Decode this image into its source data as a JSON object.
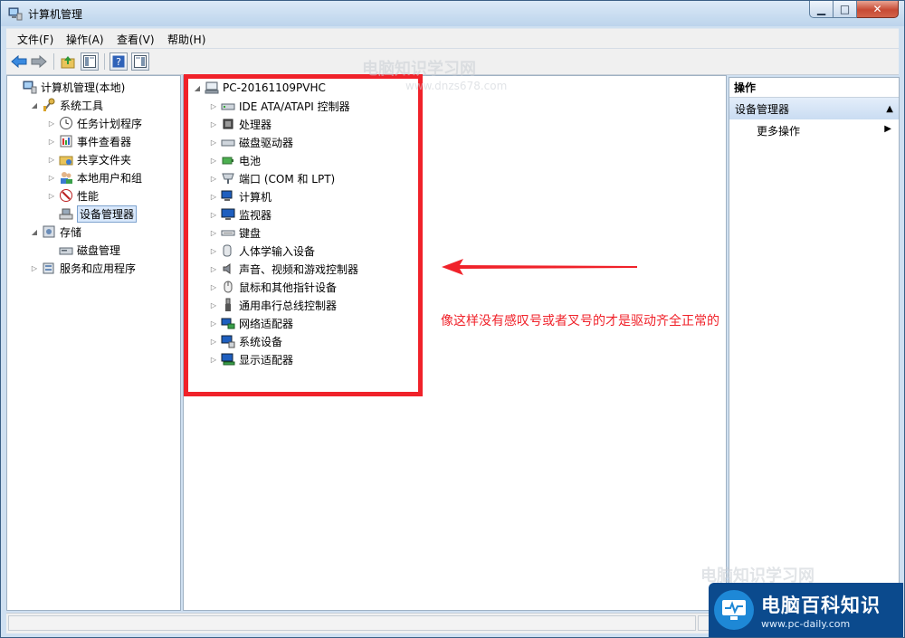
{
  "window": {
    "title": "计算机管理"
  },
  "menu": [
    "文件(F)",
    "操作(A)",
    "查看(V)",
    "帮助(H)"
  ],
  "toolbar": {
    "icons": [
      "back-arrow-icon",
      "forward-arrow-icon",
      "up-folder-icon",
      "show-tree-icon",
      "help-icon",
      "show-action-pane-icon"
    ]
  },
  "left_tree": [
    {
      "label": "计算机管理(本地)",
      "level": 0,
      "expander": "none",
      "icon": "computer-management-icon"
    },
    {
      "label": "系统工具",
      "level": 1,
      "expander": "open",
      "icon": "tools-icon"
    },
    {
      "label": "任务计划程序",
      "level": 2,
      "expander": "closed",
      "icon": "clock-icon"
    },
    {
      "label": "事件查看器",
      "level": 2,
      "expander": "closed",
      "icon": "event-viewer-icon"
    },
    {
      "label": "共享文件夹",
      "level": 2,
      "expander": "closed",
      "icon": "shared-folder-icon"
    },
    {
      "label": "本地用户和组",
      "level": 2,
      "expander": "closed",
      "icon": "users-icon"
    },
    {
      "label": "性能",
      "level": 2,
      "expander": "closed",
      "icon": "performance-icon"
    },
    {
      "label": "设备管理器",
      "level": 2,
      "expander": "none",
      "icon": "device-manager-icon",
      "selected": true
    },
    {
      "label": "存储",
      "level": 1,
      "expander": "open",
      "icon": "storage-icon"
    },
    {
      "label": "磁盘管理",
      "level": 2,
      "expander": "none",
      "icon": "disk-management-icon"
    },
    {
      "label": "服务和应用程序",
      "level": 1,
      "expander": "closed",
      "icon": "services-icon"
    }
  ],
  "device_tree": {
    "root": "PC-20161109PVHC",
    "items": [
      {
        "label": "IDE ATA/ATAPI 控制器",
        "icon": "ide-controller-icon"
      },
      {
        "label": "处理器",
        "icon": "processor-icon"
      },
      {
        "label": "磁盘驱动器",
        "icon": "disk-drive-icon"
      },
      {
        "label": "电池",
        "icon": "battery-icon"
      },
      {
        "label": "端口 (COM 和 LPT)",
        "icon": "port-icon"
      },
      {
        "label": "计算机",
        "icon": "computer-icon"
      },
      {
        "label": "监视器",
        "icon": "monitor-icon"
      },
      {
        "label": "键盘",
        "icon": "keyboard-icon"
      },
      {
        "label": "人体学输入设备",
        "icon": "hid-icon"
      },
      {
        "label": "声音、视频和游戏控制器",
        "icon": "speaker-icon"
      },
      {
        "label": "鼠标和其他指针设备",
        "icon": "mouse-icon"
      },
      {
        "label": "通用串行总线控制器",
        "icon": "usb-icon"
      },
      {
        "label": "网络适配器",
        "icon": "network-adapter-icon"
      },
      {
        "label": "系统设备",
        "icon": "system-device-icon"
      },
      {
        "label": "显示适配器",
        "icon": "display-adapter-icon"
      }
    ]
  },
  "annotation": {
    "text": "像这样没有感叹号或者叉号的才是驱动齐全正常的",
    "color": "#f0222a"
  },
  "actions": {
    "header": "操作",
    "section": "设备管理器",
    "more": "更多操作"
  },
  "watermark": {
    "text": "电脑知识学习网",
    "url": "www.dnzs678.com"
  },
  "brand": {
    "name": "电脑百科知识",
    "url": "www.pc-daily.com"
  }
}
